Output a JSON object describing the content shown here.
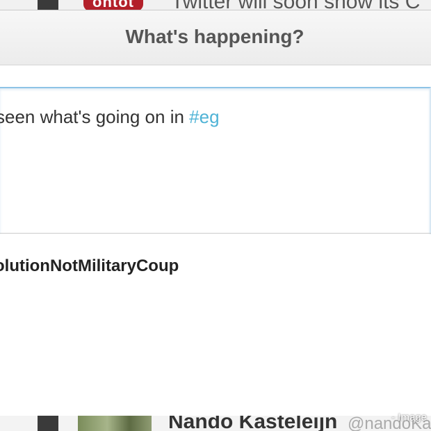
{
  "background_feed": {
    "top_badge": "ontot",
    "top_tweet": "Twitter will soon show its C",
    "bottom_user_name": "Nando Kasteleijn",
    "bottom_user_handle": "@nandoKa"
  },
  "modal": {
    "title": "What's happening?",
    "tweet_text_before": "seen what's going on in ",
    "tweet_hashtag": "#eg",
    "tag_line": "olutionNotMilitaryCoup"
  },
  "watermark": "- Image",
  "colors": {
    "hashtag": "#4fb3d6",
    "focus_border": "#8ec3e6",
    "badge_red": "#b3202a"
  }
}
